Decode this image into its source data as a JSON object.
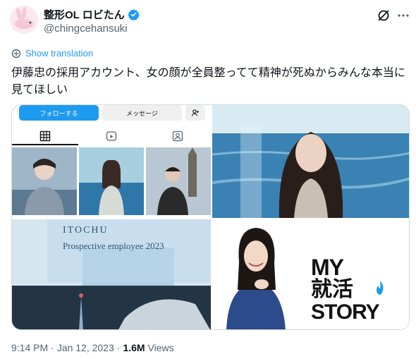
{
  "header": {
    "display_name": "整形OL ロビたん",
    "handle": "@chingcehansuki"
  },
  "translate_label": "Show translation",
  "tweet_text": "伊藤忠の採用アカウント、女の顔が全員整ってて精神が死ぬからみんな本当に見てほしい",
  "media": {
    "profile": {
      "follow_label": "フォローする",
      "message_label": "メッセージ",
      "add_icon": "add-person-icon"
    },
    "itochu": {
      "title": "ITOCHU",
      "subtitle": "Prospective employee  2023"
    },
    "story": {
      "line1": "MY",
      "line2": "就活",
      "line3": "STORY"
    }
  },
  "footer": {
    "time": "9:14 PM",
    "sep1": "·",
    "date": "Jan 12, 2023",
    "sep2": "·",
    "views_count": "1.6M",
    "views_label": "Views"
  },
  "colors": {
    "accent": "#1d9bf0",
    "text": "#0f1419",
    "muted": "#536471"
  }
}
